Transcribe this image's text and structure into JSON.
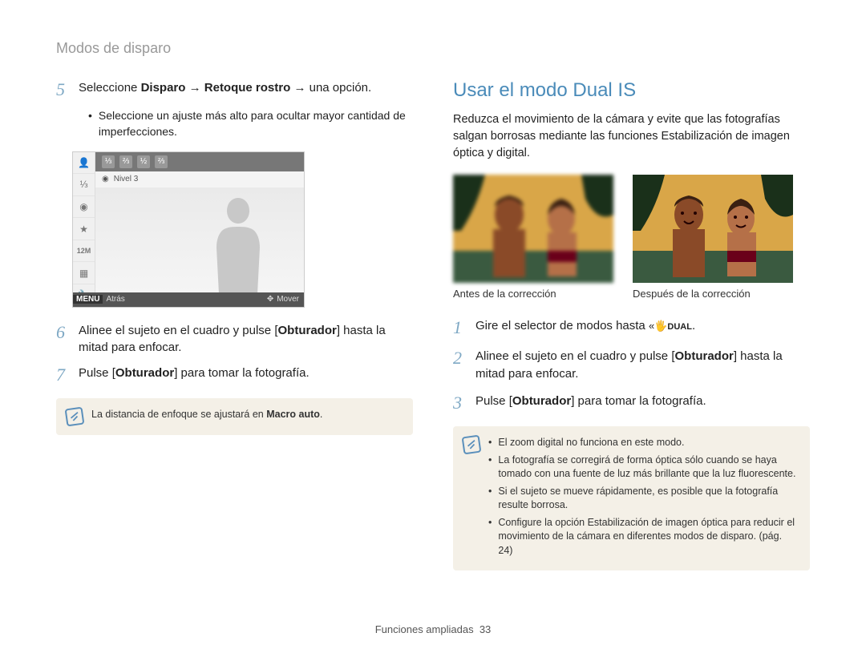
{
  "header": "Modos de disparo",
  "left": {
    "step5": {
      "num": "5",
      "text_before": "Seleccione ",
      "bold1": "Disparo",
      "arrow1": " → ",
      "bold2": "Retoque rostro",
      "arrow2": " → una opción."
    },
    "step5_sub": "Seleccione un ajuste más alto para ocultar mayor cantidad de imperfecciones.",
    "lcd": {
      "side_icons": [
        "👤",
        "⅓",
        "◉",
        "★",
        "12M",
        "▦",
        "🔧",
        "MENU"
      ],
      "level_icons": [
        "⅓",
        "⅔",
        "½",
        "⅔"
      ],
      "nivel_label": "Nivel 3",
      "footer_menu": "MENU",
      "footer_back": "Atrás",
      "footer_move": "Mover"
    },
    "step6": {
      "num": "6",
      "text_a": "Alinee el sujeto en el cuadro y pulse [",
      "bold": "Obturador",
      "text_b": "] hasta la mitad para enfocar."
    },
    "step7": {
      "num": "7",
      "text_a": "Pulse [",
      "bold": "Obturador",
      "text_b": "] para tomar la fotografía."
    },
    "note": "La distancia de enfoque se ajustará en ",
    "note_bold": "Macro auto",
    "note_end": "."
  },
  "right": {
    "title": "Usar el modo Dual IS",
    "intro": "Reduzca el movimiento de la cámara y evite que las fotografías salgan borrosas mediante las funciones Estabilización de imagen óptica y digital.",
    "caption_before": "Antes de la corrección",
    "caption_after": "Después de la corrección",
    "step1": {
      "num": "1",
      "text": "Gire el selector de modos hasta ",
      "icon": "DUAL",
      "end": "."
    },
    "step2": {
      "num": "2",
      "text_a": "Alinee el sujeto en el cuadro y pulse [",
      "bold": "Obturador",
      "text_b": "] hasta la mitad para enfocar."
    },
    "step3": {
      "num": "3",
      "text_a": "Pulse [",
      "bold": "Obturador",
      "text_b": "] para tomar la fotografía."
    },
    "notes": [
      "El zoom digital no funciona en este modo.",
      "La fotografía se corregirá de forma óptica sólo cuando se haya tomado con una fuente de luz más brillante que la luz fluorescente.",
      "Si el sujeto se mueve rápidamente, es posible que la fotografía resulte borrosa.",
      "Configure la opción Estabilización de imagen óptica para reducir el movimiento de la cámara en diferentes modos de disparo. (pág. 24)"
    ]
  },
  "footer": {
    "section": "Funciones ampliadas",
    "page": "33"
  }
}
